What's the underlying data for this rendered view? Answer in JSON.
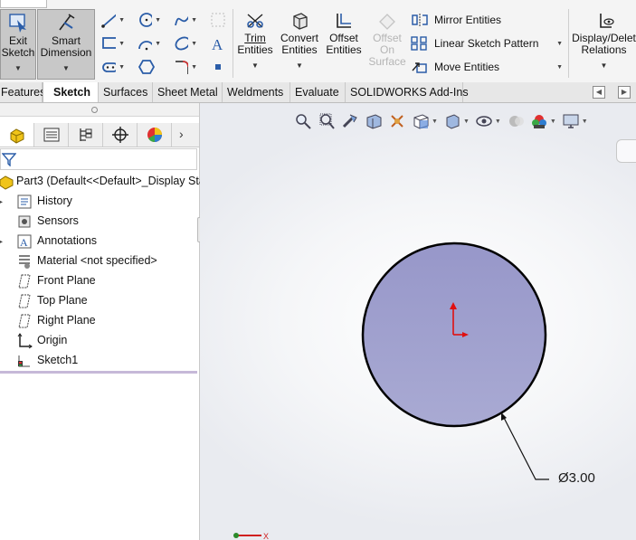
{
  "ribbon": {
    "exit_sketch": {
      "line1": "Exit",
      "line2": "Sketch"
    },
    "smart_dimension": {
      "line1": "Smart",
      "line2": "Dimension"
    },
    "trim_entities": {
      "line1": "Trim",
      "line2": "Entities"
    },
    "convert_entities": {
      "line1": "Convert",
      "line2": "Entities"
    },
    "offset_entities": {
      "line1": "Offset",
      "line2": "Entities"
    },
    "offset_on_surface": {
      "line1": "Offset",
      "line2": "On",
      "line3": "Surface"
    },
    "mirror_entities": "Mirror Entities",
    "linear_sketch_pattern": "Linear Sketch Pattern",
    "move_entities": "Move Entities",
    "display_delete_relations": {
      "line1": "Display/Delet",
      "line2": "Relations"
    }
  },
  "tabs": {
    "items": [
      "Features",
      "Sketch",
      "Surfaces",
      "Sheet Metal",
      "Weldments",
      "Evaluate",
      "SOLIDWORKS Add-Ins"
    ],
    "active": "Sketch"
  },
  "feature_tree": {
    "root": "Part3  (Default<<Default>_Display Sta",
    "items": [
      "History",
      "Sensors",
      "Annotations",
      "Material <not specified>",
      "Front Plane",
      "Top Plane",
      "Right Plane",
      "Origin",
      "Sketch1"
    ]
  },
  "viewport": {
    "dimension_label": "Ø3.00",
    "sketch_fill": "#9fa0d0",
    "origin_color": "#e01010"
  },
  "triad": {
    "axis_label": "X"
  }
}
